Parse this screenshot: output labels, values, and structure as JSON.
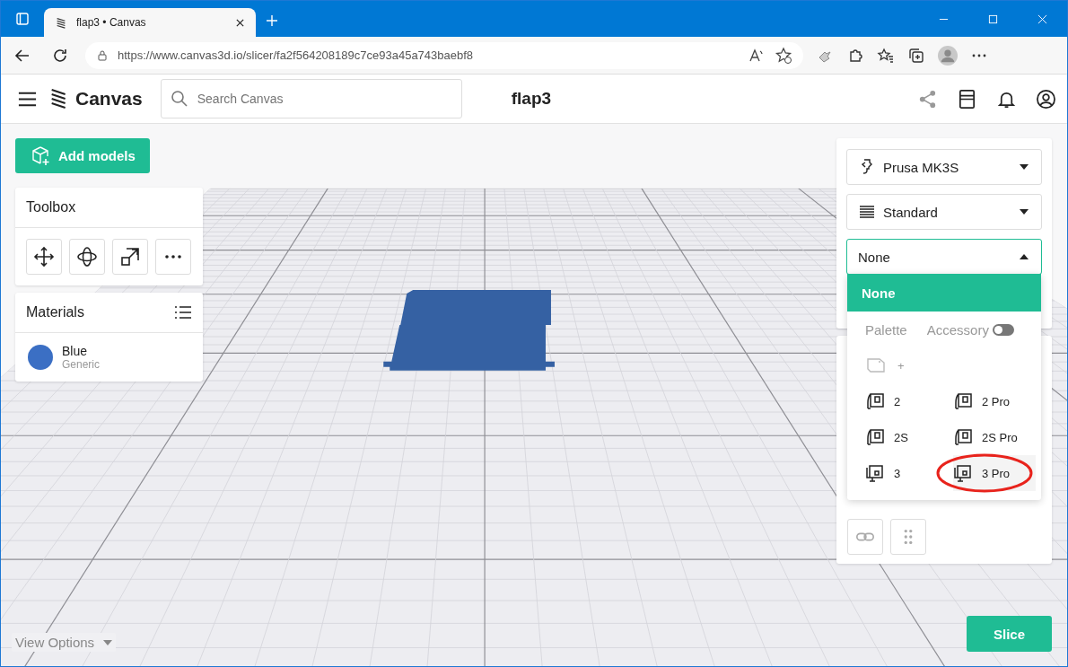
{
  "browser": {
    "tab_title": "flap3 • Canvas",
    "url": "https://www.canvas3d.io/slicer/fa2f564208189c7ce93a45a743baebf8"
  },
  "header": {
    "brand": "Canvas",
    "search": {
      "placeholder": "Search Canvas"
    },
    "title": "flap3"
  },
  "add_models": "Add models",
  "toolbox": {
    "title": "Toolbox"
  },
  "materials": {
    "title": "Materials",
    "items": [
      {
        "name": "Blue",
        "type": "Generic",
        "color": "#3b6fc4"
      }
    ]
  },
  "settings": {
    "selects": [
      {
        "kind": "printer",
        "value": "Prusa MK3S",
        "open": false
      },
      {
        "kind": "quality",
        "value": "Standard",
        "open": false
      },
      {
        "kind": "plain",
        "value": "None",
        "open": true
      }
    ]
  },
  "dropdown": {
    "top_option": {
      "label": "None",
      "selected": true
    },
    "palette_label": "Palette",
    "accessory_label": "Accessory",
    "accessory_toggle": {
      "on": false
    },
    "add_label": "+",
    "options": [
      {
        "label": "2",
        "kind": "v2",
        "selected": false,
        "circled": false
      },
      {
        "label": "2 Pro",
        "kind": "v2",
        "selected": false,
        "circled": false
      },
      {
        "label": "2S",
        "kind": "v2",
        "selected": false,
        "circled": false
      },
      {
        "label": "2S Pro",
        "kind": "v2",
        "selected": false,
        "circled": false
      },
      {
        "label": "3",
        "kind": "v3",
        "selected": false,
        "circled": false
      },
      {
        "label": "3 Pro",
        "kind": "v3",
        "selected": false,
        "circled": true
      }
    ]
  },
  "view_options": "View Options",
  "slice_button": "Slice"
}
